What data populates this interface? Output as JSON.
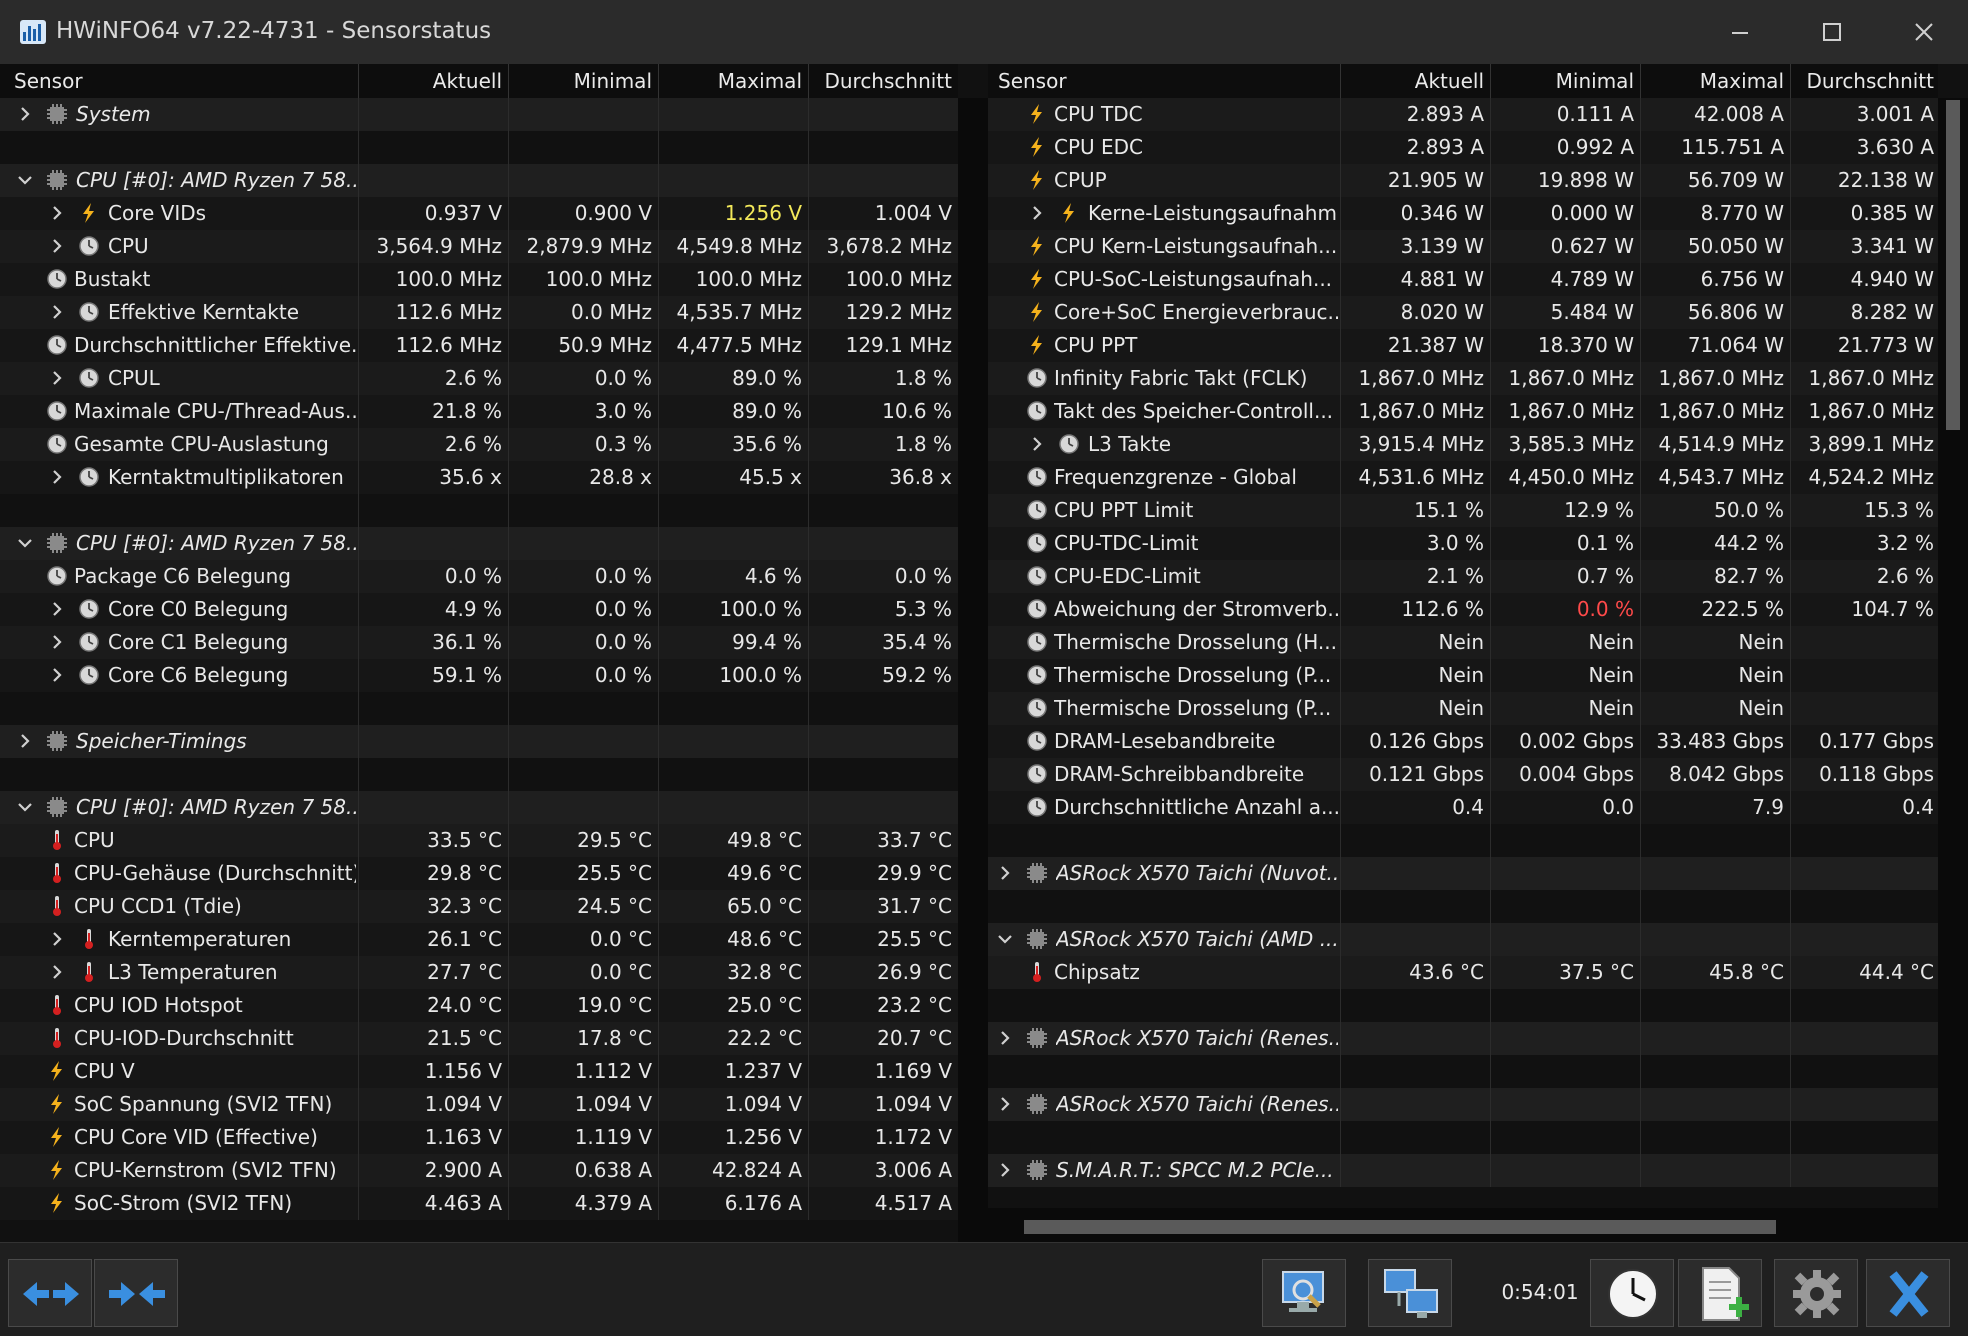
{
  "window": {
    "title": "HWiNFO64 v7.22-4731 - Sensorstatus"
  },
  "columns": {
    "sensor": "Sensor",
    "current": "Aktuell",
    "min": "Minimal",
    "max": "Maximal",
    "avg": "Durchschnitt"
  },
  "colors": {
    "highlight": "#f2e85a",
    "warning": "#ff4a4a"
  },
  "left_rows": [
    {
      "type": "group",
      "exp": "collapsed",
      "icon": "chip-icon",
      "label": "System"
    },
    {
      "type": "spacer"
    },
    {
      "type": "group",
      "exp": "expanded",
      "icon": "chip-icon",
      "label": "CPU [#0]: AMD Ryzen 7 58..."
    },
    {
      "type": "data",
      "indent": 1,
      "exp": "collapsed",
      "icon": "bolt-icon",
      "label": "Core VIDs",
      "cur": "0.937 V",
      "min": "0.900 V",
      "max": "1.256 V",
      "avg": "1.004 V",
      "max_color": "highlight"
    },
    {
      "type": "data",
      "indent": 1,
      "exp": "collapsed",
      "icon": "clock-icon",
      "label": "CPU",
      "cur": "3,564.9 MHz",
      "min": "2,879.9 MHz",
      "max": "4,549.8 MHz",
      "avg": "3,678.2 MHz"
    },
    {
      "type": "data",
      "indent": 0,
      "icon": "clock-icon",
      "label": "Bustakt",
      "cur": "100.0 MHz",
      "min": "100.0 MHz",
      "max": "100.0 MHz",
      "avg": "100.0 MHz"
    },
    {
      "type": "data",
      "indent": 1,
      "exp": "collapsed",
      "icon": "clock-icon",
      "label": "Effektive Kerntakte",
      "cur": "112.6 MHz",
      "min": "0.0 MHz",
      "max": "4,535.7 MHz",
      "avg": "129.2 MHz"
    },
    {
      "type": "data",
      "indent": 0,
      "icon": "clock-icon",
      "label": "Durchschnittlicher Effektive...",
      "cur": "112.6 MHz",
      "min": "50.9 MHz",
      "max": "4,477.5 MHz",
      "avg": "129.1 MHz"
    },
    {
      "type": "data",
      "indent": 1,
      "exp": "collapsed",
      "icon": "clock-icon",
      "label": "CPUL",
      "cur": "2.6 %",
      "min": "0.0 %",
      "max": "89.0 %",
      "avg": "1.8 %"
    },
    {
      "type": "data",
      "indent": 0,
      "icon": "clock-icon",
      "label": "Maximale CPU-/Thread-Aus...",
      "cur": "21.8 %",
      "min": "3.0 %",
      "max": "89.0 %",
      "avg": "10.6 %"
    },
    {
      "type": "data",
      "indent": 0,
      "icon": "clock-icon",
      "label": "Gesamte CPU-Auslastung",
      "cur": "2.6 %",
      "min": "0.3 %",
      "max": "35.6 %",
      "avg": "1.8 %"
    },
    {
      "type": "data",
      "indent": 1,
      "exp": "collapsed",
      "icon": "clock-icon",
      "label": "Kerntaktmultiplikatoren",
      "cur": "35.6 x",
      "min": "28.8 x",
      "max": "45.5 x",
      "avg": "36.8 x"
    },
    {
      "type": "spacer"
    },
    {
      "type": "group",
      "exp": "expanded",
      "icon": "chip-icon",
      "label": "CPU [#0]: AMD Ryzen 7 58..."
    },
    {
      "type": "data",
      "indent": 0,
      "icon": "clock-icon",
      "label": "Package C6 Belegung",
      "cur": "0.0 %",
      "min": "0.0 %",
      "max": "4.6 %",
      "avg": "0.0 %"
    },
    {
      "type": "data",
      "indent": 1,
      "exp": "collapsed",
      "icon": "clock-icon",
      "label": "Core C0 Belegung",
      "cur": "4.9 %",
      "min": "0.0 %",
      "max": "100.0 %",
      "avg": "5.3 %"
    },
    {
      "type": "data",
      "indent": 1,
      "exp": "collapsed",
      "icon": "clock-icon",
      "label": "Core C1 Belegung",
      "cur": "36.1 %",
      "min": "0.0 %",
      "max": "99.4 %",
      "avg": "35.4 %"
    },
    {
      "type": "data",
      "indent": 1,
      "exp": "collapsed",
      "icon": "clock-icon",
      "label": "Core C6 Belegung",
      "cur": "59.1 %",
      "min": "0.0 %",
      "max": "100.0 %",
      "avg": "59.2 %"
    },
    {
      "type": "spacer"
    },
    {
      "type": "group",
      "exp": "collapsed",
      "icon": "chip-icon",
      "label": "Speicher-Timings"
    },
    {
      "type": "spacer"
    },
    {
      "type": "group",
      "exp": "expanded",
      "icon": "chip-icon",
      "label": "CPU [#0]: AMD Ryzen 7 58..."
    },
    {
      "type": "data",
      "indent": 0,
      "icon": "thermometer-icon",
      "label": "CPU",
      "cur": "33.5 °C",
      "min": "29.5 °C",
      "max": "49.8 °C",
      "avg": "33.7 °C"
    },
    {
      "type": "data",
      "indent": 0,
      "icon": "thermometer-icon",
      "label": "CPU-Gehäuse (Durchschnitt)",
      "cur": "29.8 °C",
      "min": "25.5 °C",
      "max": "49.6 °C",
      "avg": "29.9 °C"
    },
    {
      "type": "data",
      "indent": 0,
      "icon": "thermometer-icon",
      "label": "CPU CCD1 (Tdie)",
      "cur": "32.3 °C",
      "min": "24.5 °C",
      "max": "65.0 °C",
      "avg": "31.7 °C"
    },
    {
      "type": "data",
      "indent": 1,
      "exp": "collapsed",
      "icon": "thermometer-icon",
      "label": "Kerntemperaturen",
      "cur": "26.1 °C",
      "min": "0.0 °C",
      "max": "48.6 °C",
      "avg": "25.5 °C"
    },
    {
      "type": "data",
      "indent": 1,
      "exp": "collapsed",
      "icon": "thermometer-icon",
      "label": "L3 Temperaturen",
      "cur": "27.7 °C",
      "min": "0.0 °C",
      "max": "32.8 °C",
      "avg": "26.9 °C"
    },
    {
      "type": "data",
      "indent": 0,
      "icon": "thermometer-icon",
      "label": "CPU IOD Hotspot",
      "cur": "24.0 °C",
      "min": "19.0 °C",
      "max": "25.0 °C",
      "avg": "23.2 °C"
    },
    {
      "type": "data",
      "indent": 0,
      "icon": "thermometer-icon",
      "label": "CPU-IOD-Durchschnitt",
      "cur": "21.5 °C",
      "min": "17.8 °C",
      "max": "22.2 °C",
      "avg": "20.7 °C"
    },
    {
      "type": "data",
      "indent": 0,
      "icon": "bolt-icon",
      "label": "CPU V",
      "cur": "1.156 V",
      "min": "1.112 V",
      "max": "1.237 V",
      "avg": "1.169 V"
    },
    {
      "type": "data",
      "indent": 0,
      "icon": "bolt-icon",
      "label": "SoC Spannung (SVI2 TFN)",
      "cur": "1.094 V",
      "min": "1.094 V",
      "max": "1.094 V",
      "avg": "1.094 V"
    },
    {
      "type": "data",
      "indent": 0,
      "icon": "bolt-icon",
      "label": "CPU Core VID (Effective)",
      "cur": "1.163 V",
      "min": "1.119 V",
      "max": "1.256 V",
      "avg": "1.172 V"
    },
    {
      "type": "data",
      "indent": 0,
      "icon": "bolt-icon",
      "label": "CPU-Kernstrom (SVI2 TFN)",
      "cur": "2.900 A",
      "min": "0.638 A",
      "max": "42.824 A",
      "avg": "3.006 A"
    },
    {
      "type": "data",
      "indent": 0,
      "icon": "bolt-icon",
      "label": "SoC-Strom (SVI2 TFN)",
      "cur": "4.463 A",
      "min": "4.379 A",
      "max": "6.176 A",
      "avg": "4.517 A"
    }
  ],
  "right_rows": [
    {
      "type": "data",
      "indent": 0,
      "icon": "bolt-icon",
      "label": "CPU TDC",
      "cur": "2.893 A",
      "min": "0.111 A",
      "max": "42.008 A",
      "avg": "3.001 A"
    },
    {
      "type": "data",
      "indent": 0,
      "icon": "bolt-icon",
      "label": "CPU EDC",
      "cur": "2.893 A",
      "min": "0.992 A",
      "max": "115.751 A",
      "avg": "3.630 A"
    },
    {
      "type": "data",
      "indent": 0,
      "icon": "bolt-icon",
      "label": "CPUP",
      "cur": "21.905 W",
      "min": "19.898 W",
      "max": "56.709 W",
      "avg": "22.138 W"
    },
    {
      "type": "data",
      "indent": 1,
      "exp": "collapsed",
      "icon": "bolt-icon",
      "label": "Kerne-Leistungsaufnahme",
      "cur": "0.346 W",
      "min": "0.000 W",
      "max": "8.770 W",
      "avg": "0.385 W"
    },
    {
      "type": "data",
      "indent": 0,
      "icon": "bolt-icon",
      "label": "CPU Kern-Leistungsaufnah...",
      "cur": "3.139 W",
      "min": "0.627 W",
      "max": "50.050 W",
      "avg": "3.341 W"
    },
    {
      "type": "data",
      "indent": 0,
      "icon": "bolt-icon",
      "label": "CPU-SoC-Leistungsaufnah...",
      "cur": "4.881 W",
      "min": "4.789 W",
      "max": "6.756 W",
      "avg": "4.940 W"
    },
    {
      "type": "data",
      "indent": 0,
      "icon": "bolt-icon",
      "label": "Core+SoC Energieverbrauc...",
      "cur": "8.020 W",
      "min": "5.484 W",
      "max": "56.806 W",
      "avg": "8.282 W"
    },
    {
      "type": "data",
      "indent": 0,
      "icon": "bolt-icon",
      "label": "CPU PPT",
      "cur": "21.387 W",
      "min": "18.370 W",
      "max": "71.064 W",
      "avg": "21.773 W"
    },
    {
      "type": "data",
      "indent": 0,
      "icon": "clock-icon",
      "label": "Infinity Fabric Takt (FCLK)",
      "cur": "1,867.0 MHz",
      "min": "1,867.0 MHz",
      "max": "1,867.0 MHz",
      "avg": "1,867.0 MHz"
    },
    {
      "type": "data",
      "indent": 0,
      "icon": "clock-icon",
      "label": "Takt des Speicher-Controll...",
      "cur": "1,867.0 MHz",
      "min": "1,867.0 MHz",
      "max": "1,867.0 MHz",
      "avg": "1,867.0 MHz"
    },
    {
      "type": "data",
      "indent": 1,
      "exp": "collapsed",
      "icon": "clock-icon",
      "label": "L3 Takte",
      "cur": "3,915.4 MHz",
      "min": "3,585.3 MHz",
      "max": "4,514.9 MHz",
      "avg": "3,899.1 MHz"
    },
    {
      "type": "data",
      "indent": 0,
      "icon": "clock-icon",
      "label": "Frequenzgrenze - Global",
      "cur": "4,531.6 MHz",
      "min": "4,450.0 MHz",
      "max": "4,543.7 MHz",
      "avg": "4,524.2 MHz"
    },
    {
      "type": "data",
      "indent": 0,
      "icon": "clock-icon",
      "label": "CPU PPT Limit",
      "cur": "15.1 %",
      "min": "12.9 %",
      "max": "50.0 %",
      "avg": "15.3 %"
    },
    {
      "type": "data",
      "indent": 0,
      "icon": "clock-icon",
      "label": "CPU-TDC-Limit",
      "cur": "3.0 %",
      "min": "0.1 %",
      "max": "44.2 %",
      "avg": "3.2 %"
    },
    {
      "type": "data",
      "indent": 0,
      "icon": "clock-icon",
      "label": "CPU-EDC-Limit",
      "cur": "2.1 %",
      "min": "0.7 %",
      "max": "82.7 %",
      "avg": "2.6 %"
    },
    {
      "type": "data",
      "indent": 0,
      "icon": "clock-icon",
      "label": "Abweichung der Stromverb...",
      "cur": "112.6 %",
      "min": "0.0 %",
      "max": "222.5 %",
      "avg": "104.7 %",
      "min_color": "warning"
    },
    {
      "type": "data",
      "indent": 0,
      "icon": "clock-icon",
      "label": "Thermische Drosselung (H...",
      "cur": "Nein",
      "min": "Nein",
      "max": "Nein",
      "avg": ""
    },
    {
      "type": "data",
      "indent": 0,
      "icon": "clock-icon",
      "label": "Thermische Drosselung (P...",
      "cur": "Nein",
      "min": "Nein",
      "max": "Nein",
      "avg": ""
    },
    {
      "type": "data",
      "indent": 0,
      "icon": "clock-icon",
      "label": "Thermische Drosselung (P...",
      "cur": "Nein",
      "min": "Nein",
      "max": "Nein",
      "avg": ""
    },
    {
      "type": "data",
      "indent": 0,
      "icon": "clock-icon",
      "label": "DRAM-Lesebandbreite",
      "cur": "0.126 Gbps",
      "min": "0.002 Gbps",
      "max": "33.483 Gbps",
      "avg": "0.177 Gbps"
    },
    {
      "type": "data",
      "indent": 0,
      "icon": "clock-icon",
      "label": "DRAM-Schreibbandbreite",
      "cur": "0.121 Gbps",
      "min": "0.004 Gbps",
      "max": "8.042 Gbps",
      "avg": "0.118 Gbps"
    },
    {
      "type": "data",
      "indent": 0,
      "icon": "clock-icon",
      "label": "Durchschnittliche Anzahl a...",
      "cur": "0.4",
      "min": "0.0",
      "max": "7.9",
      "avg": "0.4"
    },
    {
      "type": "spacer"
    },
    {
      "type": "group",
      "exp": "collapsed",
      "icon": "chip-icon",
      "label": "ASRock X570 Taichi (Nuvot..."
    },
    {
      "type": "spacer"
    },
    {
      "type": "group",
      "exp": "expanded",
      "icon": "chip-icon",
      "label": "ASRock X570 Taichi (AMD ..."
    },
    {
      "type": "data",
      "indent": 0,
      "icon": "thermometer-icon",
      "label": "Chipsatz",
      "cur": "43.6 °C",
      "min": "37.5 °C",
      "max": "45.8 °C",
      "avg": "44.4 °C"
    },
    {
      "type": "spacer"
    },
    {
      "type": "group",
      "exp": "collapsed",
      "icon": "chip-icon",
      "label": "ASRock X570 Taichi (Renes..."
    },
    {
      "type": "spacer"
    },
    {
      "type": "group",
      "exp": "collapsed",
      "icon": "chip-icon",
      "label": "ASRock X570 Taichi (Renes..."
    },
    {
      "type": "spacer"
    },
    {
      "type": "group",
      "exp": "collapsed",
      "icon": "chip-icon",
      "label": "S.M.A.R.T.: SPCC M.2 PCIe..."
    }
  ],
  "toolbar": {
    "elapsed": "0:54:01"
  }
}
